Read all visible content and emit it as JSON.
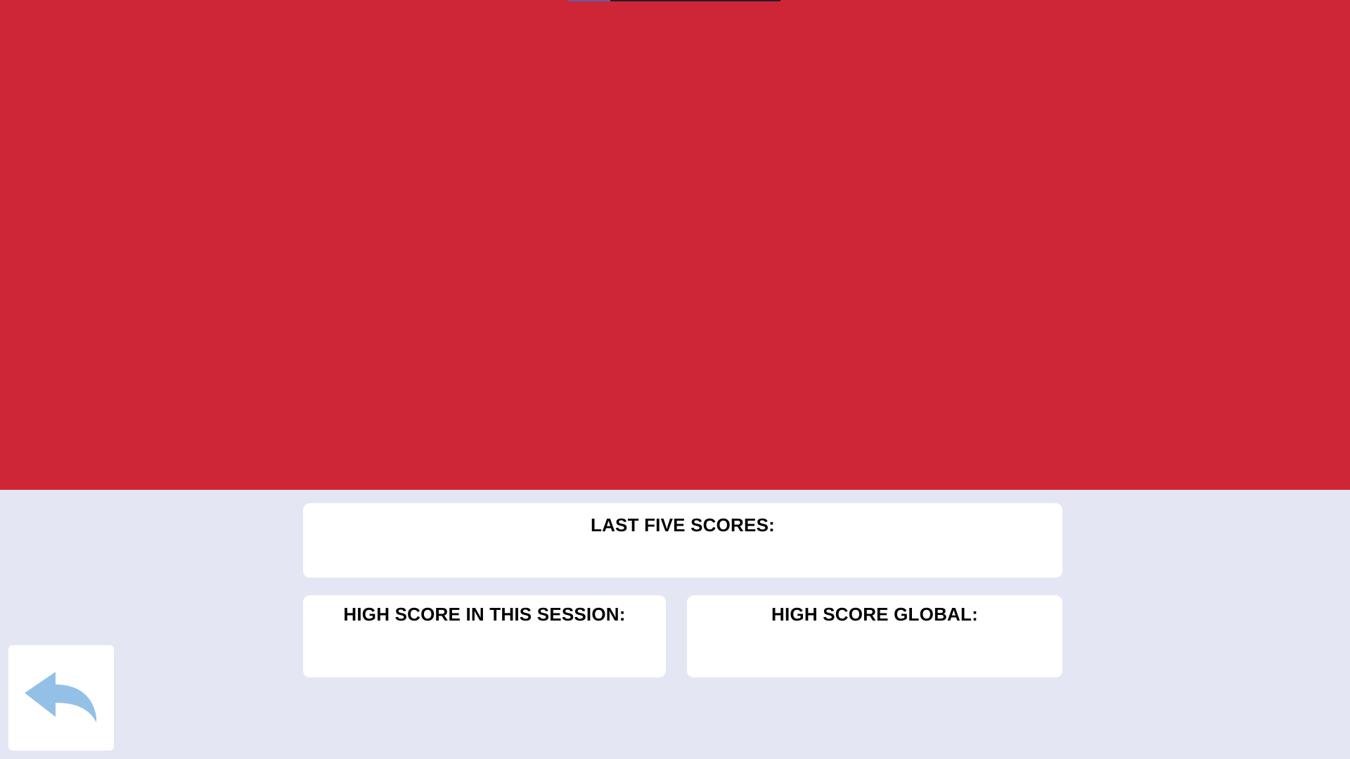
{
  "progress": {
    "fraction": 0.2,
    "fill_color": "#6a5aa6",
    "track_color": "#2b1a2a"
  },
  "colors": {
    "game_area": "#cf2637",
    "background": "#e4e7f3",
    "card": "#ffffff",
    "back_arrow": "#93c0e6"
  },
  "scores": {
    "last_five": {
      "label": "LAST FIVE SCORES:",
      "value": ""
    },
    "session_high": {
      "label": "HIGH SCORE IN THIS SESSION:",
      "value": ""
    },
    "global_high": {
      "label": "HIGH SCORE GLOBAL:",
      "value": ""
    }
  },
  "back_button": {
    "icon": "reply-arrow-icon"
  }
}
